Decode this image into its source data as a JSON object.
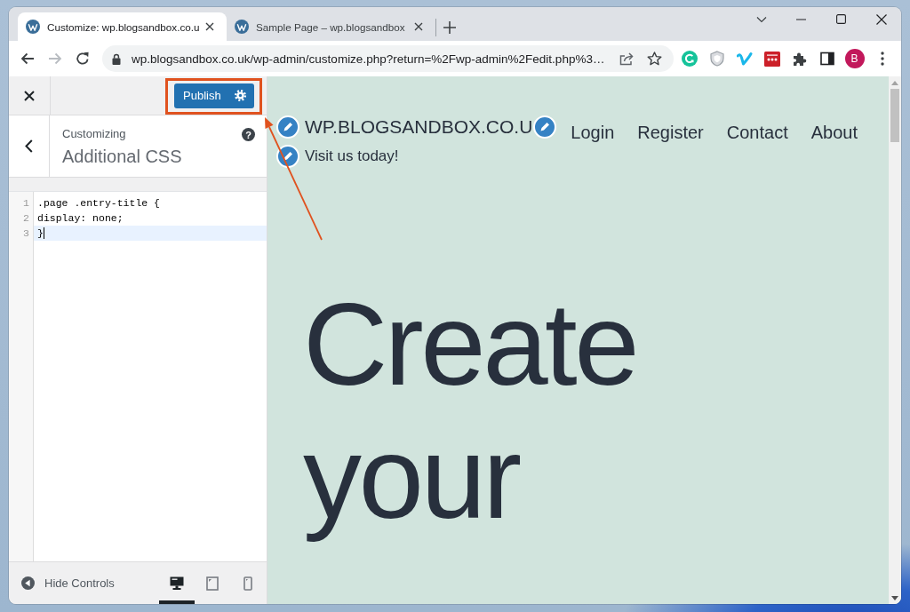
{
  "browser": {
    "tabs": [
      {
        "title": "Customize: wp.blogsandbox.co.u",
        "selected": true
      },
      {
        "title": "Sample Page – wp.blogsandbox",
        "selected": false
      }
    ],
    "forward_disabled": true,
    "url": "wp.blogsandbox.co.uk/wp-admin/customize.php?return=%2Fwp-admin%2Fedit.php%3…",
    "avatar": "B"
  },
  "customizer": {
    "publish": "Publish",
    "subtitle": "Customizing",
    "title": "Additional CSS",
    "help": "?",
    "code": [
      {
        "number": "1",
        "text": ".page .entry-title {",
        "active": false
      },
      {
        "number": "2",
        "text": "display: none;",
        "active": false
      },
      {
        "number": "3",
        "text": "}",
        "active": true
      }
    ],
    "hide_controls": "Hide Controls",
    "devices": [
      {
        "kind": "desktop",
        "selected": true
      },
      {
        "kind": "tablet",
        "selected": false
      },
      {
        "kind": "mobile",
        "selected": false
      }
    ]
  },
  "preview": {
    "site_title": "WP.BLOGSANDBOX.CO.U",
    "tagline": "Visit us today!",
    "nav": [
      "Login",
      "Register",
      "Contact",
      "About"
    ],
    "heading": "Create your"
  },
  "annotation": {
    "frame": true,
    "arrow": true
  }
}
